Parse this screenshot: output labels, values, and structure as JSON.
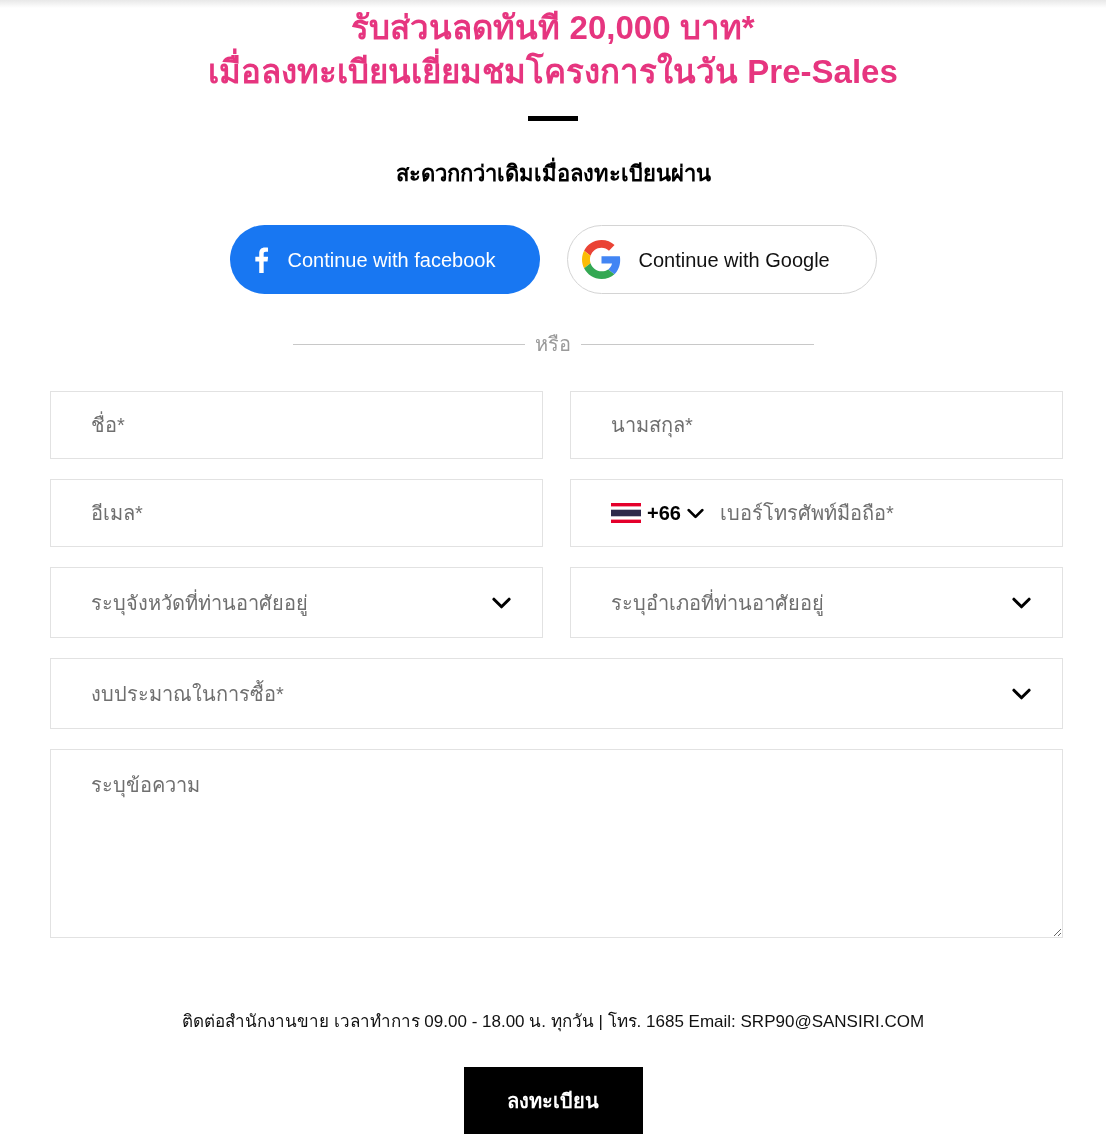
{
  "headline": [
    "รับส่วนลดทันที 20,000 บาท*",
    "เมื่อลงทะเบียนเยี่ยมชมโครงการในวัน Pre-Sales"
  ],
  "subheading": "สะดวกกว่าเดิมเมื่อลงทะเบียนผ่าน",
  "social_buttons": [
    {
      "kind": "facebook",
      "label": "Continue with facebook"
    },
    {
      "kind": "google",
      "label": "Continue with Google"
    }
  ],
  "divider": "หรือ",
  "form_rows": [
    [
      {
        "kind": "text",
        "placeholder": "ชื่อ*"
      },
      {
        "kind": "text",
        "placeholder": "นามสกุล*"
      }
    ],
    [
      {
        "kind": "text",
        "placeholder": "อีเมล*"
      },
      {
        "kind": "phone",
        "country_code": "+66",
        "placeholder": "เบอร์โทรศัพท์มือถือ*"
      }
    ],
    [
      {
        "kind": "select",
        "placeholder": "ระบุจังหวัดที่ท่านอาศัยอยู่"
      },
      {
        "kind": "select",
        "placeholder": "ระบุอำเภอที่ท่านอาศัยอยู่"
      }
    ],
    [
      {
        "kind": "select",
        "placeholder": "งบประมาณในการซื้อ*"
      }
    ],
    [
      {
        "kind": "textarea",
        "placeholder": "ระบุข้อความ"
      }
    ]
  ],
  "contact": "ติดต่อสำนักงานขาย เวลาทำการ 09.00 - 18.00 น. ทุกวัน | โทร. 1685 Email: SRP90@SANSIRI.COM",
  "submit_button": "ลงทะเบียน"
}
